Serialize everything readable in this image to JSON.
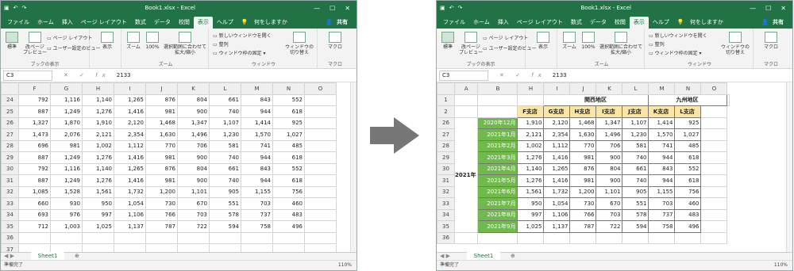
{
  "titlebar": {
    "title": "Book1.xlsx - Excel",
    "min_icon": "minimize-icon",
    "max_icon": "maximize-icon",
    "close_icon": "close-icon"
  },
  "tabs": [
    "ファイル",
    "ホーム",
    "挿入",
    "ページ レイアウト",
    "数式",
    "データ",
    "校閲",
    "表示",
    "ヘルプ"
  ],
  "search_label": "何をしますか",
  "share_label": "共有",
  "ribbon": {
    "group_book_views": "ブックの表示",
    "btn_normal": "標準",
    "btn_pagebreak": "改ページ\nプレビュー",
    "btn_pagelayout": "ページ レイアウト",
    "btn_userview": "ユーザー設定のビュー",
    "btn_show": "表示",
    "group_zoom": "ズーム",
    "btn_zoom": "ズーム",
    "btn_100": "100%",
    "btn_zoomsel": "選択範囲に合わせて\n拡大/縮小",
    "group_window": "ウィンドウ",
    "btn_newwin": "新しいウィンドウを開く",
    "btn_arrange": "整列",
    "btn_freeze": "ウィンドウ枠の固定",
    "btn_switch": "ウィンドウの\n切り替え",
    "group_macro": "マクロ",
    "btn_macro": "マクロ"
  },
  "formula": {
    "namebox": "C3",
    "value": "2133"
  },
  "left": {
    "cols": [
      "F",
      "G",
      "H",
      "I",
      "J",
      "K",
      "L",
      "M",
      "N",
      "O"
    ],
    "rows": [
      {
        "n": "24",
        "v": [
          "792",
          "1,116",
          "1,140",
          "1,265",
          "876",
          "804",
          "661",
          "843",
          "552",
          ""
        ]
      },
      {
        "n": "25",
        "v": [
          "887",
          "1,249",
          "1,276",
          "1,416",
          "981",
          "900",
          "740",
          "944",
          "618",
          ""
        ]
      },
      {
        "n": "26",
        "v": [
          "1,327",
          "1,870",
          "1,910",
          "2,120",
          "1,468",
          "1,347",
          "1,107",
          "1,414",
          "925",
          ""
        ]
      },
      {
        "n": "27",
        "v": [
          "1,473",
          "2,076",
          "2,121",
          "2,354",
          "1,630",
          "1,496",
          "1,230",
          "1,570",
          "1,027",
          ""
        ]
      },
      {
        "n": "28",
        "v": [
          "696",
          "981",
          "1,002",
          "1,112",
          "770",
          "706",
          "581",
          "741",
          "485",
          ""
        ]
      },
      {
        "n": "29",
        "v": [
          "887",
          "1,249",
          "1,276",
          "1,416",
          "981",
          "900",
          "740",
          "944",
          "618",
          ""
        ]
      },
      {
        "n": "30",
        "v": [
          "792",
          "1,116",
          "1,140",
          "1,265",
          "876",
          "804",
          "661",
          "843",
          "552",
          ""
        ]
      },
      {
        "n": "31",
        "v": [
          "887",
          "1,249",
          "1,276",
          "1,416",
          "981",
          "900",
          "740",
          "944",
          "618",
          ""
        ]
      },
      {
        "n": "32",
        "v": [
          "1,085",
          "1,528",
          "1,561",
          "1,732",
          "1,200",
          "1,101",
          "905",
          "1,155",
          "756",
          ""
        ]
      },
      {
        "n": "33",
        "v": [
          "660",
          "930",
          "950",
          "1,054",
          "730",
          "670",
          "551",
          "703",
          "460",
          ""
        ]
      },
      {
        "n": "34",
        "v": [
          "693",
          "976",
          "997",
          "1,106",
          "766",
          "703",
          "578",
          "737",
          "483",
          ""
        ]
      },
      {
        "n": "35",
        "v": [
          "712",
          "1,003",
          "1,025",
          "1,137",
          "787",
          "722",
          "594",
          "758",
          "496",
          ""
        ]
      },
      {
        "n": "36",
        "v": [
          "",
          "",
          "",
          "",
          "",
          "",
          "",
          "",
          "",
          ""
        ]
      },
      {
        "n": "37",
        "v": [
          "",
          "",
          "",
          "",
          "",
          "",
          "",
          "",
          "",
          ""
        ]
      }
    ]
  },
  "right": {
    "cols": [
      "A",
      "B",
      "H",
      "I",
      "J",
      "K",
      "L",
      "M",
      "N",
      "O"
    ],
    "region1": "関西地区",
    "region2": "九州地区",
    "stores": [
      "F支店",
      "G支店",
      "H支店",
      "I支店",
      "J支店",
      "K支店",
      "L支店"
    ],
    "year": "2021年",
    "rows": [
      {
        "n": "26",
        "m": "2020年12月",
        "v": [
          "1,910",
          "2,120",
          "1,468",
          "1,347",
          "1,107",
          "1,414",
          "925"
        ]
      },
      {
        "n": "27",
        "m": "2021年1月",
        "v": [
          "2,121",
          "2,354",
          "1,630",
          "1,496",
          "1,230",
          "1,570",
          "1,027"
        ]
      },
      {
        "n": "28",
        "m": "2021年2月",
        "v": [
          "1,002",
          "1,112",
          "770",
          "706",
          "581",
          "741",
          "485"
        ]
      },
      {
        "n": "29",
        "m": "2021年3月",
        "v": [
          "1,276",
          "1,416",
          "981",
          "900",
          "740",
          "944",
          "618"
        ]
      },
      {
        "n": "30",
        "m": "2021年4月",
        "v": [
          "1,140",
          "1,265",
          "876",
          "804",
          "661",
          "843",
          "552"
        ]
      },
      {
        "n": "31",
        "m": "2021年5月",
        "v": [
          "1,276",
          "1,416",
          "981",
          "900",
          "740",
          "944",
          "618"
        ]
      },
      {
        "n": "32",
        "m": "2021年6月",
        "v": [
          "1,561",
          "1,732",
          "1,200",
          "1,101",
          "905",
          "1,155",
          "756"
        ]
      },
      {
        "n": "33",
        "m": "2021年7月",
        "v": [
          "950",
          "1,054",
          "730",
          "670",
          "551",
          "703",
          "460"
        ]
      },
      {
        "n": "34",
        "m": "2021年8月",
        "v": [
          "997",
          "1,106",
          "766",
          "703",
          "578",
          "737",
          "483"
        ]
      },
      {
        "n": "35",
        "m": "2021年9月",
        "v": [
          "1,025",
          "1,137",
          "787",
          "722",
          "594",
          "758",
          "496"
        ]
      },
      {
        "n": "36",
        "m": "",
        "v": [
          "",
          "",
          "",
          "",
          "",
          "",
          ""
        ]
      }
    ]
  },
  "sheet_tab": "Sheet1",
  "status_text": "準備完了",
  "zoom_text": "110%",
  "colors": {
    "excel_green": "#217346",
    "header_fill": "#fbe5a4",
    "month_fill": "#70b94b"
  }
}
